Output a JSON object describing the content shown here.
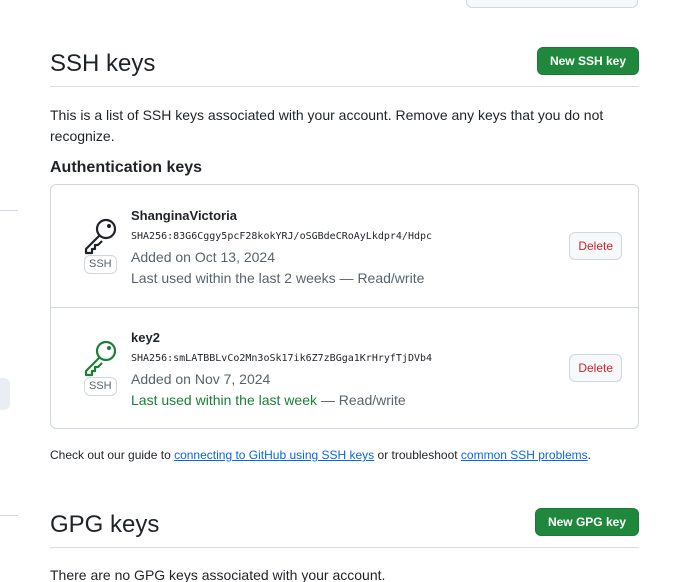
{
  "ssh_section": {
    "title": "SSH keys",
    "new_button_label": "New SSH key",
    "description": "This is a list of SSH keys associated with your account. Remove any keys that you do not recognize.",
    "subheading": "Authentication keys",
    "keys": [
      {
        "name": "ShanginaVictoria",
        "fingerprint": "SHA256:83G6Cggy5pcF28kokYRJ/oSGBdeCRoAyLkdpr4/Hdpc",
        "added": "Added on Oct 13, 2024",
        "last_used": "Last used within the last 2 weeks",
        "access": " — Read/write",
        "badge": "SSH",
        "icon": "key-icon",
        "icon_color": "#1f2328",
        "delete_label": "Delete"
      },
      {
        "name": "key2",
        "fingerprint": "SHA256:smLATBBLvCo2Mn3oSk17ik6Z7zBGga1KrHryfTjDVb4",
        "added": "Added on Nov 7, 2024",
        "last_used": "Last used within the last week",
        "access": " — Read/write",
        "badge": "SSH",
        "icon": "key-icon",
        "icon_color": "#1a7f37",
        "delete_label": "Delete"
      }
    ],
    "guide": {
      "prefix": "Check out our guide to ",
      "link1": "connecting to GitHub using SSH keys",
      "middle": " or troubleshoot ",
      "link2": "common SSH problems",
      "suffix": "."
    }
  },
  "gpg_section": {
    "title": "GPG keys",
    "new_button_label": "New GPG key",
    "empty_text": "There are no GPG keys associated with your account."
  },
  "colors": {
    "primary_button": "#1f883d",
    "danger_text": "#d1242f",
    "link": "#0969da",
    "recent_used": "#1a7f37"
  }
}
